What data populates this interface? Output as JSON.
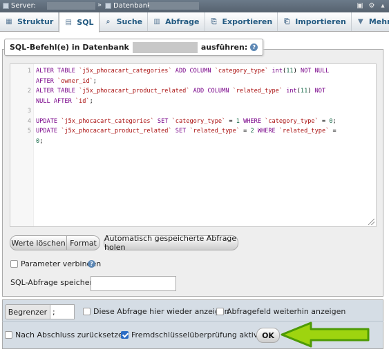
{
  "topbar": {
    "server_label": "Server:",
    "database_label": "Datenbank:",
    "separator": "»"
  },
  "tabs": [
    {
      "label": "Struktur",
      "icon": "table-structure-icon"
    },
    {
      "label": "SQL",
      "icon": "sql-icon",
      "active": true
    },
    {
      "label": "Suche",
      "icon": "search-icon"
    },
    {
      "label": "Abfrage",
      "icon": "query-icon"
    },
    {
      "label": "Exportieren",
      "icon": "export-icon"
    },
    {
      "label": "Importieren",
      "icon": "import-icon"
    },
    {
      "label": "Mehr",
      "icon": "chevron-down-icon"
    }
  ],
  "sql_panel": {
    "legend_prefix": "SQL-Befehl(e) in Datenbank",
    "legend_suffix": "ausführen:",
    "code_lines": [
      {
        "n": "1",
        "parts": [
          [
            "kw",
            "ALTER TABLE "
          ],
          [
            "str",
            "`j5x_phocacart_categories`"
          ],
          [
            "kw",
            " ADD COLUMN "
          ],
          [
            "str",
            "`category_type`"
          ],
          [
            "kw",
            " int"
          ],
          [
            "",
            "("
          ],
          [
            "num",
            "11"
          ],
          [
            "",
            ") "
          ],
          [
            "kw",
            "NOT NULL"
          ]
        ]
      },
      {
        "n": "",
        "parts": [
          [
            "kw",
            "AFTER "
          ],
          [
            "str",
            "`owner_id`"
          ],
          [
            "",
            ";"
          ]
        ]
      },
      {
        "n": "2",
        "parts": [
          [
            "kw",
            "ALTER TABLE "
          ],
          [
            "str",
            "`j5x_phocacart_product_related`"
          ],
          [
            "kw",
            " ADD COLUMN "
          ],
          [
            "str",
            "`related_type`"
          ],
          [
            "kw",
            " int"
          ],
          [
            "",
            "("
          ],
          [
            "num",
            "11"
          ],
          [
            "",
            ") "
          ],
          [
            "kw",
            "NOT"
          ]
        ]
      },
      {
        "n": "",
        "parts": [
          [
            "kw",
            "NULL AFTER "
          ],
          [
            "str",
            "`id`"
          ],
          [
            "",
            ";"
          ]
        ]
      },
      {
        "n": "3",
        "parts": []
      },
      {
        "n": "4",
        "parts": [
          [
            "kw",
            "UPDATE "
          ],
          [
            "str",
            "`j5x_phocacart_categories`"
          ],
          [
            "kw",
            " SET "
          ],
          [
            "str",
            "`category_type`"
          ],
          [
            "",
            " = "
          ],
          [
            "num",
            "1"
          ],
          [
            "kw",
            " WHERE "
          ],
          [
            "str",
            "`category_type`"
          ],
          [
            "",
            " = "
          ],
          [
            "num",
            "0"
          ],
          [
            "",
            ";"
          ]
        ]
      },
      {
        "n": "5",
        "parts": [
          [
            "kw",
            "UPDATE "
          ],
          [
            "str",
            "`j5x_phocacart_product_related`"
          ],
          [
            "kw",
            " SET "
          ],
          [
            "str",
            "`related_type`"
          ],
          [
            "",
            " = "
          ],
          [
            "num",
            "2"
          ],
          [
            "kw",
            " WHERE "
          ],
          [
            "str",
            "`related_type`"
          ],
          [
            "",
            " ="
          ]
        ]
      },
      {
        "n": "",
        "parts": [
          [
            "num",
            "0"
          ],
          [
            "",
            ";"
          ]
        ]
      }
    ]
  },
  "buttons": {
    "clear": "Werte löschen",
    "format": "Format",
    "autosave": "Automatisch gespeicherte Abfrage holen",
    "ok": "OK"
  },
  "options": {
    "bind_params": "Parameter verbinden",
    "save_query_label": "SQL-Abfrage speichern:",
    "save_query_value": "",
    "delimiter_label": "Begrenzer",
    "delimiter_value": ";",
    "show_again": "Diese Abfrage hier wieder anzeigen",
    "keep_box": "Abfragefeld weiterhin anzeigen",
    "rollback": "Nach Abschluss zurücksetzen",
    "fk_checks": "Fremdschlüsselüberprüfung aktivieren"
  },
  "colors": {
    "arrow": "#9ed40f",
    "arrow_border": "#4e9a06"
  }
}
